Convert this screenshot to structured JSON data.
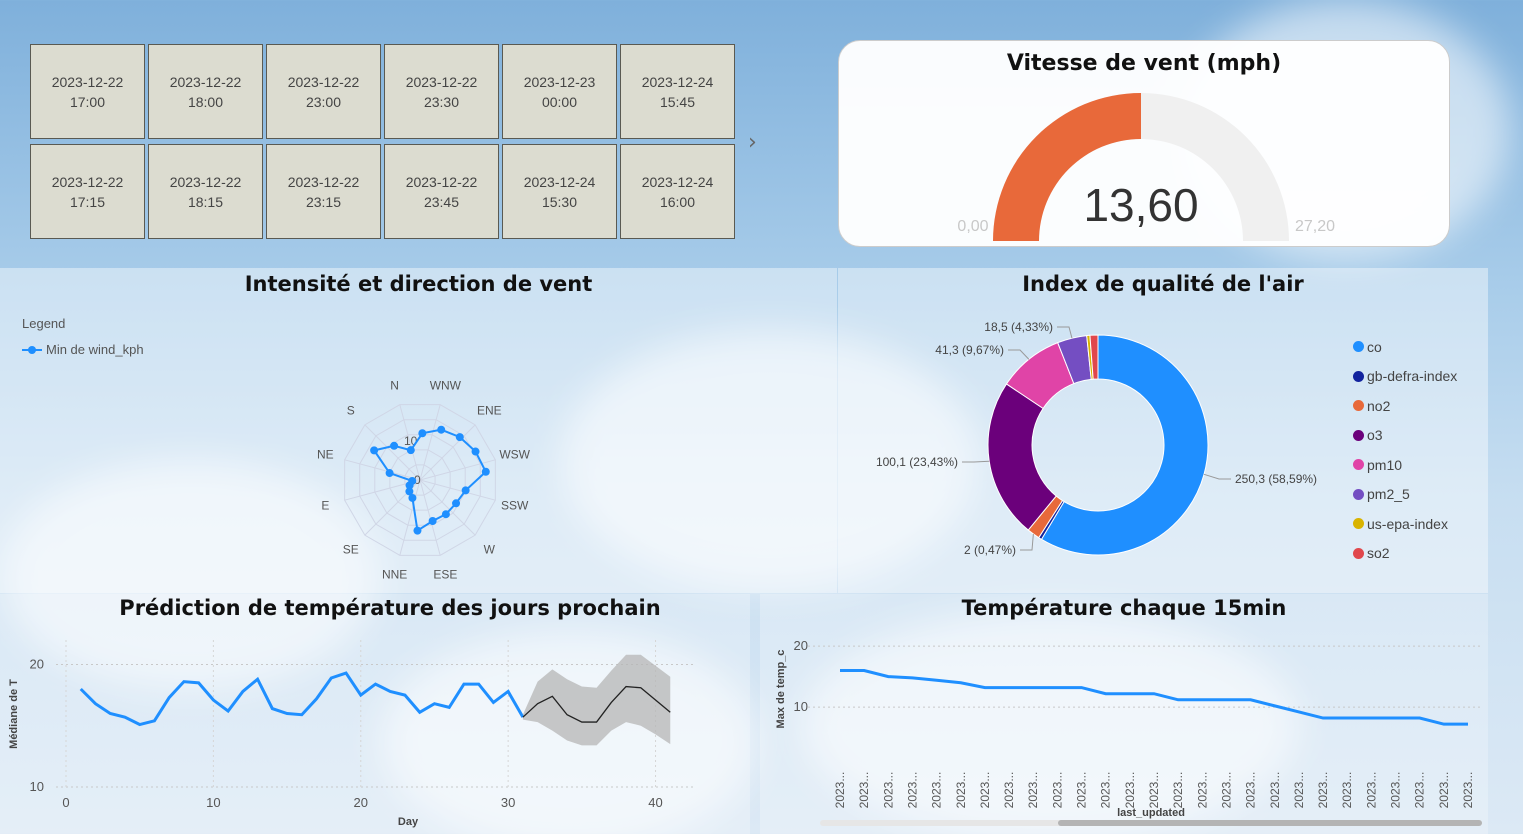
{
  "slicer": {
    "tiles": [
      {
        "date": "2023-12-22",
        "time": "17:00"
      },
      {
        "date": "2023-12-22",
        "time": "18:00"
      },
      {
        "date": "2023-12-22",
        "time": "23:00"
      },
      {
        "date": "2023-12-22",
        "time": "23:30"
      },
      {
        "date": "2023-12-23",
        "time": "00:00"
      },
      {
        "date": "2023-12-24",
        "time": "15:45"
      },
      {
        "date": "2023-12-22",
        "time": "17:15"
      },
      {
        "date": "2023-12-22",
        "time": "18:15"
      },
      {
        "date": "2023-12-22",
        "time": "23:15"
      },
      {
        "date": "2023-12-22",
        "time": "23:45"
      },
      {
        "date": "2023-12-24",
        "time": "15:30"
      },
      {
        "date": "2023-12-24",
        "time": "16:00"
      }
    ],
    "next_icon": "chevron-right-icon"
  },
  "gauge": {
    "title": "Vitesse de vent (mph)",
    "value": 13.6,
    "value_label": "13,60",
    "min": 0,
    "min_label": "0,00",
    "max": 27.2,
    "max_label": "27,20",
    "fill_color": "#e8693a",
    "track_color": "#f0f0f0"
  },
  "radar": {
    "title": "Intensité et direction de vent",
    "legend_title": "Legend",
    "legend_item": "Min de wind_kph",
    "color": "#1f8fff",
    "directions": [
      "N",
      "WNW",
      "ENE",
      "WSW",
      "SSW",
      "W",
      "ESE",
      "NNE",
      "SE",
      "E",
      "NE",
      "S"
    ],
    "tick_labels": [
      "0",
      "10"
    ],
    "chart_data": {
      "type": "radar",
      "series": [
        {
          "name": "Min de wind_kph",
          "values": [
            12,
            14,
            15,
            16,
            17,
            12,
            11,
            11,
            11,
            13,
            5,
            4,
            3,
            2,
            8,
            14,
            11,
            8
          ]
        }
      ],
      "rlim": [
        0,
        20
      ]
    }
  },
  "air": {
    "title": "Index de qualité de l'air",
    "legend": [
      {
        "name": "co",
        "color": "#1f8fff"
      },
      {
        "name": "gb-defra-index",
        "color": "#12239e"
      },
      {
        "name": "no2",
        "color": "#e8693a"
      },
      {
        "name": "o3",
        "color": "#6b007b"
      },
      {
        "name": "pm10",
        "color": "#e044a7"
      },
      {
        "name": "pm2_5",
        "color": "#744ec2"
      },
      {
        "name": "us-epa-index",
        "color": "#d9b300"
      },
      {
        "name": "so2",
        "color": "#e0474c"
      }
    ],
    "labels": {
      "co": "250,3 (58,59%)",
      "o3": "100,1 (23,43%)",
      "pm10": "41,3 (9,67%)",
      "pm2_5": "18,5 (4,33%)",
      "no2": "2 (0,47%)"
    },
    "chart_data": {
      "type": "pie",
      "donut": true,
      "categories": [
        "co",
        "gb-defra-index",
        "no2",
        "o3",
        "pm10",
        "pm2_5",
        "us-epa-index",
        "so2"
      ],
      "values": [
        250.3,
        2.0,
        8.0,
        100.1,
        41.3,
        18.5,
        2.0,
        5.0
      ]
    }
  },
  "forecast": {
    "title": "Prédiction de température des jours prochain",
    "xlabel": "Day",
    "ylabel": "Médiane de T",
    "x_ticks": [
      "0",
      "10",
      "20",
      "30",
      "40"
    ],
    "y_ticks": [
      "10",
      "20"
    ],
    "chart_data": {
      "type": "line",
      "x": [
        1,
        2,
        3,
        4,
        5,
        6,
        7,
        8,
        9,
        10,
        11,
        12,
        13,
        14,
        15,
        16,
        17,
        18,
        19,
        20,
        21,
        22,
        23,
        24,
        25,
        26,
        27,
        28,
        29,
        30,
        31
      ],
      "series": [
        {
          "name": "",
          "values": [
            18,
            16.8,
            16,
            15.7,
            15.1,
            15.4,
            17.3,
            18.6,
            18.5,
            17.1,
            16.2,
            17.8,
            18.8,
            16.4,
            16,
            15.9,
            17.2,
            18.9,
            19.3,
            17.5,
            18.4,
            17.8,
            17.5,
            16.1,
            16.8,
            16.5,
            18.4,
            18.4,
            16.9,
            17.8,
            15.7
          ]
        }
      ],
      "forecast": {
        "x": [
          31,
          32,
          33,
          34,
          35,
          36,
          37,
          38,
          39,
          40,
          41
        ],
        "mean": [
          15.7,
          16.8,
          17.4,
          15.9,
          15.3,
          15.3,
          16.9,
          18.2,
          18.1,
          17.1,
          16.1
        ],
        "lower": [
          15.5,
          15.3,
          14.6,
          13.8,
          13.4,
          13.4,
          14.6,
          15.3,
          15.0,
          14.3,
          13.5
        ],
        "upper": [
          15.9,
          18.6,
          19.6,
          18.8,
          18.2,
          18.1,
          19.5,
          20.8,
          20.8,
          19.9,
          19.0
        ]
      },
      "xlim": [
        0,
        42
      ],
      "ylim": [
        10,
        22
      ],
      "line_color": "#1f8fff",
      "forecast_color": "#222222",
      "band_color": "#b5b5b5"
    }
  },
  "temp15": {
    "title": "Température chaque 15min",
    "xlabel": "last_updated",
    "ylabel": "Max de temp_c",
    "y_ticks": [
      "10",
      "20"
    ],
    "x_tick_label": "2023...",
    "chart_data": {
      "type": "line",
      "categories": [
        "2023...",
        "2023...",
        "2023...",
        "2023...",
        "2023...",
        "2023...",
        "2023...",
        "2023...",
        "2023...",
        "2023...",
        "2023...",
        "2023...",
        "2023...",
        "2023...",
        "2023...",
        "2023...",
        "2023...",
        "2023...",
        "2023...",
        "2023...",
        "2023...",
        "2023...",
        "2023...",
        "2023...",
        "2023...",
        "2023...",
        "2023..."
      ],
      "values": [
        16,
        16,
        15,
        14.8,
        14.4,
        14,
        13.2,
        13.2,
        13.2,
        13.2,
        13.2,
        12.2,
        12.2,
        12.2,
        11.2,
        11.2,
        11.2,
        11.2,
        10.2,
        9.2,
        8.2,
        8.2,
        8.2,
        8.2,
        8.2,
        7.2,
        7.2
      ],
      "ylim": [
        0,
        22
      ],
      "line_color": "#1f8fff"
    }
  }
}
